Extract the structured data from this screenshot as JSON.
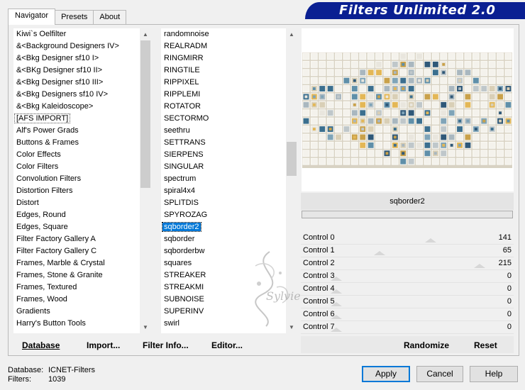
{
  "tabs": [
    "Navigator",
    "Presets",
    "About"
  ],
  "banner_title": "Filters Unlimited 2.0",
  "categories": [
    "Kiwi`s Oelfilter",
    "&<Background Designers IV>",
    "&<Bkg Designer sf10 I>",
    "&<BKg Designer sf10 II>",
    "&<Bkg Designer sf10 III>",
    "&<Bkg Designers sf10 IV>",
    "&<Bkg Kaleidoscope>",
    "[AFS IMPORT]",
    "Alf's Power Grads",
    "Buttons & Frames",
    "Color Effects",
    "Color Filters",
    "Convolution Filters",
    "Distortion Filters",
    "Distort",
    "Edges, Round",
    "Edges, Square",
    "Filter Factory Gallery A",
    "Filter Factory Gallery C",
    "Frames, Marble & Crystal",
    "Frames, Stone & Granite",
    "Frames, Textured",
    "Frames, Wood",
    "Gradients",
    "Harry's Button Tools"
  ],
  "filters": [
    "randomnoise",
    "REALRADM",
    "RINGMIRR",
    "RINGTILE",
    "RIPPIXEL",
    "RIPPLEMI",
    "ROTATOR",
    "SECTORMO",
    "seethru",
    "SETTRANS",
    "SIERPENS",
    "SINGULAR",
    "spectrum",
    "spiral4x4",
    "SPLITDIS",
    "SPYROZAG",
    "sqborder2",
    "sqborder",
    "sqborderbw",
    "squares",
    "STREAKER",
    "STREAKMI",
    "SUBNOISE",
    "SUPERINV",
    "swirl"
  ],
  "selected_filter_index": 16,
  "selected_category_index": 7,
  "filter_name": "sqborder2",
  "controls": [
    {
      "label": "Control 0",
      "value": "141",
      "level": 0.553
    },
    {
      "label": "Control 1",
      "value": "65",
      "level": 0.255
    },
    {
      "label": "Control 2",
      "value": "215",
      "level": 0.843
    },
    {
      "label": "Control 3",
      "value": "0",
      "level": 0
    },
    {
      "label": "Control 4",
      "value": "0",
      "level": 0
    },
    {
      "label": "Control 5",
      "value": "0",
      "level": 0
    },
    {
      "label": "Control 6",
      "value": "0",
      "level": 0
    },
    {
      "label": "Control 7",
      "value": "0",
      "level": 0
    }
  ],
  "bottom_buttons": {
    "database": "Database",
    "import": "Import...",
    "filter_info": "Filter Info...",
    "editor": "Editor...",
    "randomize": "Randomize",
    "reset": "Reset"
  },
  "status": {
    "database_label": "Database:",
    "database_value": "ICNET-Filters",
    "filters_label": "Filters:",
    "filters_value": "1039"
  },
  "dialog_buttons": {
    "apply": "Apply",
    "cancel": "Cancel",
    "help": "Help"
  },
  "watermark_text": "Sylvie",
  "colors": {
    "banner": "#0a1f92",
    "selection": "#0078d7"
  }
}
